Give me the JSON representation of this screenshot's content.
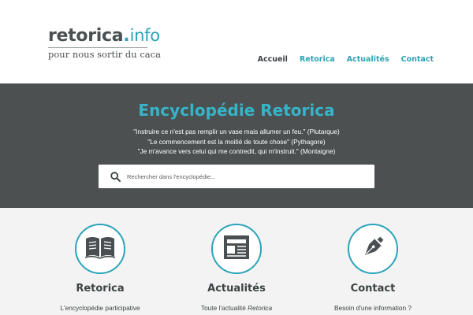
{
  "logo": {
    "name": "retorica",
    "dot": ".",
    "tld": "info",
    "tagline": "pour nous sortir du caca"
  },
  "nav": {
    "items": [
      {
        "label": "Accueil",
        "active": true
      },
      {
        "label": "Retorica",
        "active": false
      },
      {
        "label": "Actualités",
        "active": false
      },
      {
        "label": "Contact",
        "active": false
      }
    ]
  },
  "hero": {
    "title": "Encyclopédie Retorica",
    "quotes": [
      "\"Instruire ce n'est pas remplir un vase mais allumer un feu.\" (Plutarque)",
      "\"Le commencement est la moitié de toute chose\" (Pythagore)",
      "\"Je m'avance vers celui qui me contredit, qui m'instruit.\" (Montaigne)"
    ]
  },
  "search": {
    "placeholder": "Rechercher dans l'encyclopédie...",
    "icon": "search-icon"
  },
  "features": [
    {
      "icon": "book-icon",
      "title": "Retorica",
      "desc": "L'encyclopédie participative"
    },
    {
      "icon": "newspaper-icon",
      "title": "Actualités",
      "desc_prefix": "Toute l'actualité ",
      "desc_em": "Retorica"
    },
    {
      "icon": "fountain-pen-icon",
      "title": "Contact",
      "desc": "Besoin d'une information ?"
    }
  ],
  "colors": {
    "accent": "#2aa3b8",
    "hero_bg": "#4c5051",
    "features_bg": "#f3f3f3",
    "text": "#3d4244"
  }
}
